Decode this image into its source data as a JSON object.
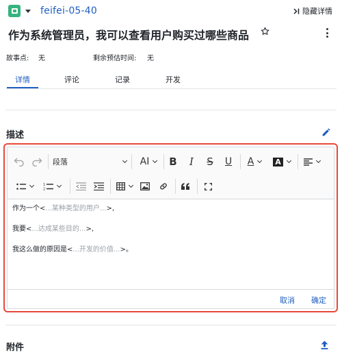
{
  "header": {
    "issue_key": "feifei-05-40",
    "hide_details": "隐藏详情",
    "type_icon": "story-icon"
  },
  "issue": {
    "title": "作为系统管理员，我可以查看用户购买过哪些商品"
  },
  "meta": {
    "story_points_label": "故事点:",
    "story_points_value": "无",
    "remaining_label": "剩余预估时间:",
    "remaining_value": "无"
  },
  "tabs": [
    {
      "label": "详情",
      "active": true
    },
    {
      "label": "评论",
      "active": false
    },
    {
      "label": "记录",
      "active": false
    },
    {
      "label": "开发",
      "active": false
    }
  ],
  "description": {
    "heading": "描述"
  },
  "editor": {
    "paragraph_style": "段落",
    "lines": [
      {
        "prefix": "作为一个<",
        "placeholder": "...某种类型的用户...",
        "suffix": ">,"
      },
      {
        "prefix": "我要<",
        "placeholder": "...达成某些目的...",
        "suffix": ">,"
      },
      {
        "prefix": "我这么做的原因是<",
        "placeholder": "...开发的价值...",
        "suffix": ">。"
      }
    ],
    "cancel_label": "取消",
    "confirm_label": "确定"
  },
  "attachments": {
    "heading": "附件"
  },
  "colors": {
    "accent": "#1f5fbf",
    "story": "#36b37e",
    "focus_border": "#e8483b"
  }
}
